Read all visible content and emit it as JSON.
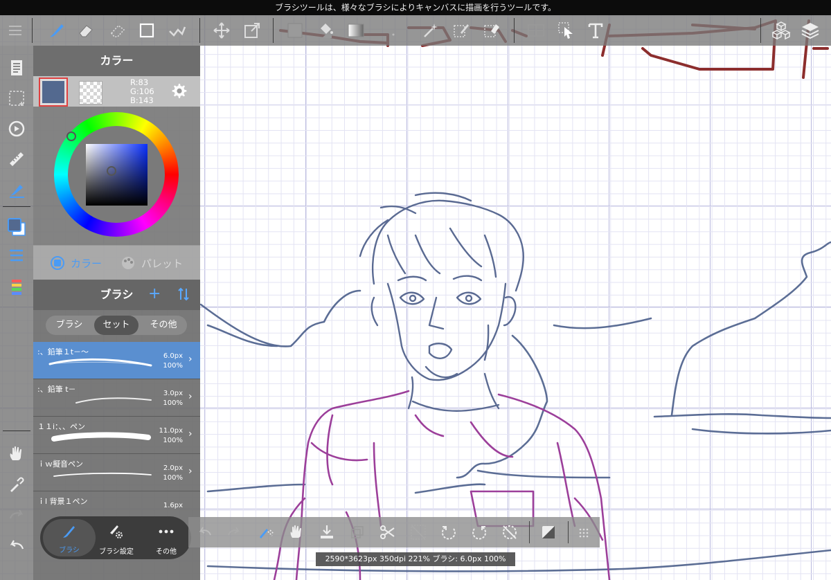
{
  "hint": "ブラシツールは、様々なブラシによりキャンバスに描画を行うツールです。",
  "toolbar": {
    "icons": [
      "menu-icon",
      "brush-icon",
      "eraser-icon",
      "blur-icon",
      "rect-icon",
      "snap-icon",
      "move-icon",
      "transform-icon",
      "fill-rect-icon",
      "bucket-icon",
      "gradient-icon",
      "dot-icon",
      "magic-wand-icon",
      "select-pen-icon",
      "select-eraser-icon",
      "frame-icon",
      "select-arrow-icon",
      "text-icon",
      "material-icon",
      "layers-icon"
    ]
  },
  "color_panel": {
    "title": "カラー",
    "fg_color": "#53698f",
    "rgb": {
      "r": "R:83",
      "g": "G:106",
      "b": "B:143"
    },
    "tab_color": "カラー",
    "tab_palette": "パレット",
    "accent": "#4a9bf5"
  },
  "brush_panel": {
    "title": "ブラシ",
    "add": "+",
    "segments": [
      "ブラシ",
      "セット",
      "その他"
    ],
    "items": [
      {
        "name": ":、鉛筆１t－～",
        "size": "6.0px",
        "opacity": "100%",
        "selected": true
      },
      {
        "name": ":、鉛筆 t－",
        "size": "3.0px",
        "opacity": "100%",
        "selected": false
      },
      {
        "name": "１１i：、、ペン",
        "size": "11.0px",
        "opacity": "100%",
        "selected": false
      },
      {
        "name": "ｉｗ擬音ペン",
        "size": "2.0px",
        "opacity": "100%",
        "selected": false
      },
      {
        "name": "ｉl 背景１ペン",
        "size": "1.6px",
        "opacity": "",
        "selected": false
      }
    ],
    "bottom_tabs": {
      "brush": "ブラシ",
      "settings": "ブラシ設定",
      "other": "その他"
    }
  },
  "status": "2590*3623px 350dpi 221% ブラシ: 6.0px 100%"
}
